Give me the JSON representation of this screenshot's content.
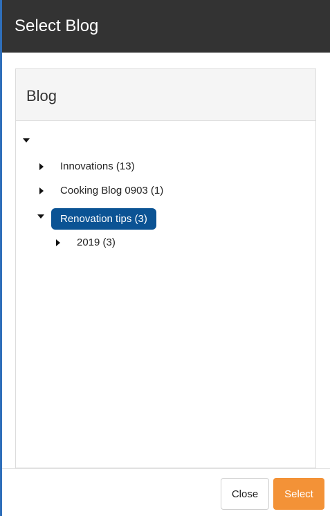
{
  "dialog": {
    "title": "Select Blog"
  },
  "panel": {
    "title": "Blog"
  },
  "tree": {
    "root": {
      "expanded": true
    },
    "items": [
      {
        "label": "Innovations (13)",
        "expanded": false
      },
      {
        "label": "Cooking Blog 0903 (1)",
        "expanded": false
      },
      {
        "label": "Renovation tips (3)",
        "expanded": true,
        "selected": true,
        "children": [
          {
            "label": "2019 (3)",
            "expanded": false
          }
        ]
      }
    ]
  },
  "footer": {
    "close_label": "Close",
    "select_label": "Select"
  },
  "colors": {
    "titlebar_bg": "#333333",
    "selected_bg": "#0b5394",
    "select_button_bg": "#f39237",
    "frame_border": "#2f6fba"
  },
  "icons": {
    "expanded": "caret-down-icon",
    "collapsed": "caret-right-icon"
  }
}
